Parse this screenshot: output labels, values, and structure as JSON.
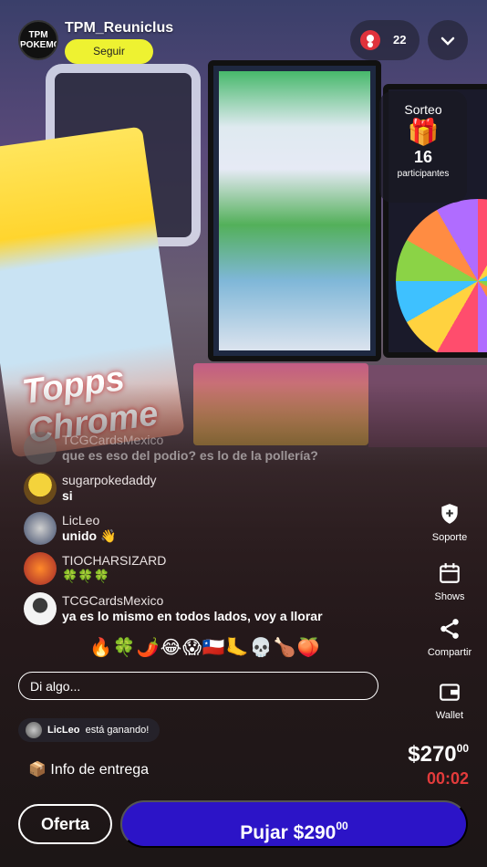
{
  "header": {
    "username": "TPM_Reuniclus",
    "avatar_text": "TPM POKEMON",
    "follow_label": "Seguir",
    "viewer_count": "22"
  },
  "raffle": {
    "title": "Sorteo",
    "count": "16",
    "label": "participantes"
  },
  "scene": {
    "pack_text": "Topps Chrome"
  },
  "chat": {
    "messages": [
      {
        "user": "TCGCardsMexico",
        "text": "que es eso del podio? es lo de la pollería?"
      },
      {
        "user": "sugarpokedaddy",
        "text": "si"
      },
      {
        "user": "LicLeo",
        "text": "unido 👋"
      },
      {
        "user": "TIOCHARSIZARD",
        "text": "🍀🍀🍀"
      },
      {
        "user": "TCGCardsMexico",
        "text": "ya es lo mismo en todos lados, voy a llorar"
      }
    ],
    "reactions": "🔥🍀🌶️😂😱🇨🇱🦶💀🍗🍑",
    "input_placeholder": "Di algo..."
  },
  "side_actions": {
    "support": "Soporte",
    "shows": "Shows",
    "share": "Compartir",
    "wallet": "Wallet"
  },
  "winner": {
    "user": "LicLeo",
    "text": "está ganando!"
  },
  "delivery": {
    "label": "📦 Info de entrega"
  },
  "auction": {
    "price": "$270",
    "price_cents": "00",
    "timer": "00:02",
    "offer_label": "Oferta",
    "bid_label": "Pujar $290",
    "bid_cents": "00"
  },
  "colors": {
    "follow": "#eef231",
    "bid": "#2c14c7",
    "timer": "#e23b3b",
    "viewer_icon": "#e0323c"
  }
}
